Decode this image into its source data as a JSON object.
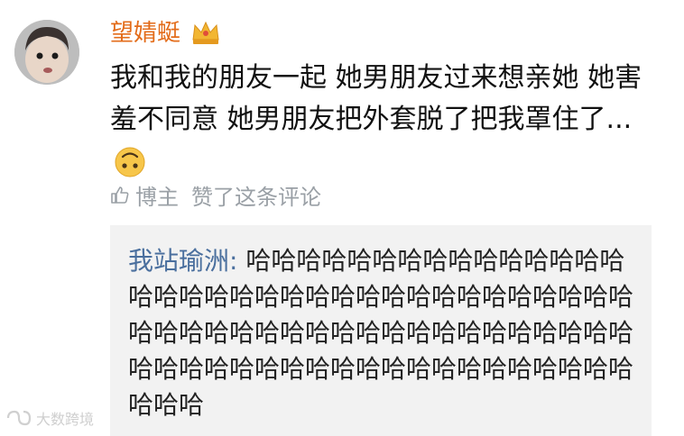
{
  "post": {
    "author": "望婧蜓",
    "text_part1": "我和我的朋友一起 她男朋友过来想亲她 她害羞不同意 她男朋友把外套脱了把我罩住了",
    "ellipsis": "...",
    "badge_icon": "crown-icon",
    "emoji_icon": "upside-down-face-emoji"
  },
  "like_row": {
    "icon": "thumbs-up-icon",
    "label": "博主",
    "text": "赞了这条评论"
  },
  "reply": {
    "author": "我站瑜洲:",
    "text": "哈哈哈哈哈哈哈哈哈哈哈哈哈哈哈哈哈哈哈哈哈哈哈哈哈哈哈哈哈哈哈哈哈哈哈哈哈哈哈哈哈哈哈哈哈哈哈哈哈哈哈哈哈哈哈哈哈哈哈哈哈哈哈哈哈哈哈哈哈哈哈哈哈哈哈哈哈哈"
  },
  "watermark": {
    "text": "大数跨境"
  }
}
